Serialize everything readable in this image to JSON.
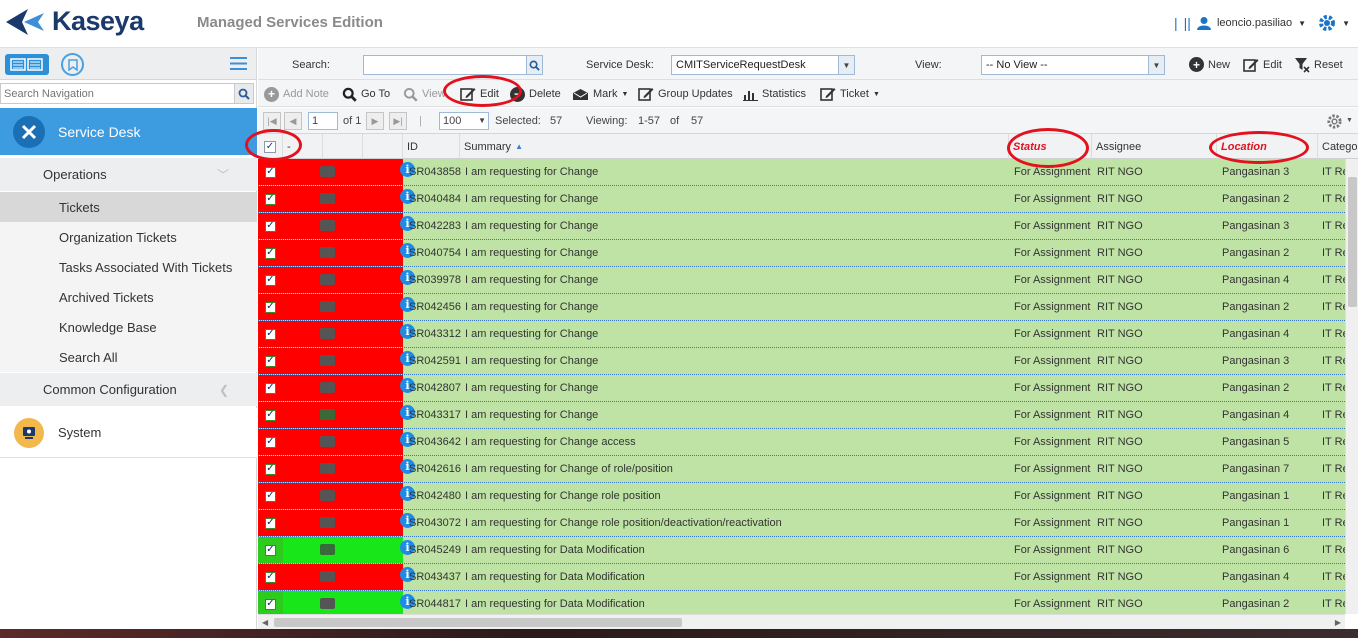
{
  "app": {
    "logo": "Kaseya",
    "edition": "Managed Services Edition",
    "user": "leoncio.pasiliao"
  },
  "nav": {
    "search_placeholder": "Search Navigation",
    "module": "Service Desk",
    "groups": [
      {
        "label": "Operations"
      },
      {
        "label": "Common Configuration"
      }
    ],
    "items": [
      {
        "label": "Tickets"
      },
      {
        "label": "Organization Tickets"
      },
      {
        "label": "Tasks Associated With Tickets"
      },
      {
        "label": "Archived Tickets"
      },
      {
        "label": "Knowledge Base"
      },
      {
        "label": "Search All"
      }
    ],
    "system": "System"
  },
  "filters": {
    "search_label": "Search:",
    "search_value": "",
    "desk_label": "Service Desk:",
    "desk_value": "CMITServiceRequestDesk",
    "view_label": "View:",
    "view_value": "-- No View --",
    "new_label": "New",
    "edit_label": "Edit",
    "reset_label": "Reset"
  },
  "toolbar": {
    "add_note": "Add Note",
    "go_to": "Go To",
    "view": "View",
    "edit": "Edit",
    "delete": "Delete",
    "mark": "Mark",
    "group_updates": "Group Updates",
    "statistics": "Statistics",
    "ticket": "Ticket"
  },
  "pager": {
    "page": "1",
    "of_label": "of 1",
    "page_size": "100",
    "selected_label": "Selected:",
    "selected": "57",
    "viewing_label": "Viewing:",
    "viewing_range": "1-57",
    "viewing_of": "of",
    "total": "57"
  },
  "columns": {
    "dash": "-",
    "id": "ID",
    "summary": "Summary",
    "status": "Status",
    "assignee": "Assignee",
    "location": "Location",
    "category": "Catego"
  },
  "rows": [
    {
      "id": "SR043858",
      "summary": "I am requesting for Change",
      "status": "For Assignment",
      "assignee": "RIT NGO",
      "location": "Pangasinan 3",
      "category": "IT Re",
      "color": "#ff0000",
      "mail": "closed"
    },
    {
      "id": "SR040484",
      "summary": "I am requesting for Change",
      "status": "For Assignment",
      "assignee": "RIT NGO",
      "location": "Pangasinan 2",
      "category": "IT Re",
      "color": "#ff0000",
      "mail": "closed"
    },
    {
      "id": "SR042283",
      "summary": "I am requesting for Change",
      "status": "For Assignment",
      "assignee": "RIT NGO",
      "location": "Pangasinan 3",
      "category": "IT Re",
      "color": "#ff0000",
      "mail": "closed"
    },
    {
      "id": "SR040754",
      "summary": "I am requesting for Change",
      "status": "For Assignment",
      "assignee": "RIT NGO",
      "location": "Pangasinan 2",
      "category": "IT Re",
      "color": "#ff0000",
      "mail": "closed"
    },
    {
      "id": "SR039978",
      "summary": "I am requesting for Change",
      "status": "For Assignment",
      "assignee": "RIT NGO",
      "location": "Pangasinan 4",
      "category": "IT Re",
      "color": "#ff0000",
      "mail": "closed"
    },
    {
      "id": "SR042456",
      "summary": "I am requesting for Change",
      "status": "For Assignment",
      "assignee": "RIT NGO",
      "location": "Pangasinan 2",
      "category": "IT Re",
      "color": "#ff0000",
      "mail": "closed"
    },
    {
      "id": "SR043312",
      "summary": "I am requesting for Change",
      "status": "For Assignment",
      "assignee": "RIT NGO",
      "location": "Pangasinan 4",
      "category": "IT Re",
      "color": "#ff0000",
      "mail": "closed"
    },
    {
      "id": "SR042591",
      "summary": "I am requesting for Change",
      "status": "For Assignment",
      "assignee": "RIT NGO",
      "location": "Pangasinan 3",
      "category": "IT Re",
      "color": "#ff0000",
      "mail": "closed"
    },
    {
      "id": "SR042807",
      "summary": "I am requesting for Change",
      "status": "For Assignment",
      "assignee": "RIT NGO",
      "location": "Pangasinan 2",
      "category": "IT Re",
      "color": "#ff0000",
      "mail": "closed"
    },
    {
      "id": "SR043317",
      "summary": "I am requesting for Change",
      "status": "For Assignment",
      "assignee": "RIT NGO",
      "location": "Pangasinan 4",
      "category": "IT Re",
      "color": "#ff0000",
      "mail": "open"
    },
    {
      "id": "SR043642",
      "summary": "I am requesting for Change access",
      "status": "For Assignment",
      "assignee": "RIT NGO",
      "location": "Pangasinan 5",
      "category": "IT Re",
      "color": "#ff0000",
      "mail": "closed"
    },
    {
      "id": "SR042616",
      "summary": "I am requesting for Change of role/position",
      "status": "For Assignment",
      "assignee": "RIT NGO",
      "location": "Pangasinan 7",
      "category": "IT Re",
      "color": "#ff0000",
      "mail": "closed"
    },
    {
      "id": "SR042480",
      "summary": "I am requesting for Change role position",
      "status": "For Assignment",
      "assignee": "RIT NGO",
      "location": "Pangasinan 1",
      "category": "IT Re",
      "color": "#ff0000",
      "mail": "closed"
    },
    {
      "id": "SR043072",
      "summary": "I am requesting for Change role position/deactivation/reactivation",
      "status": "For Assignment",
      "assignee": "RIT NGO",
      "location": "Pangasinan 1",
      "category": "IT Re",
      "color": "#ff0000",
      "mail": "closed"
    },
    {
      "id": "SR045249",
      "summary": "I am requesting for Data Modification",
      "status": "For Assignment",
      "assignee": "RIT NGO",
      "location": "Pangasinan 6",
      "category": "IT Re",
      "color": "#19e619",
      "mail": "open"
    },
    {
      "id": "SR043437",
      "summary": "I am requesting for Data Modification",
      "status": "For Assignment",
      "assignee": "RIT NGO",
      "location": "Pangasinan 4",
      "category": "IT Re",
      "color": "#ff0000",
      "mail": "closed"
    },
    {
      "id": "SR044817",
      "summary": "I am requesting for Data Modification",
      "status": "For Assignment",
      "assignee": "RIT NGO",
      "location": "Pangasinan 2",
      "category": "IT Re",
      "color": "#19e619",
      "mail": "closed"
    }
  ]
}
